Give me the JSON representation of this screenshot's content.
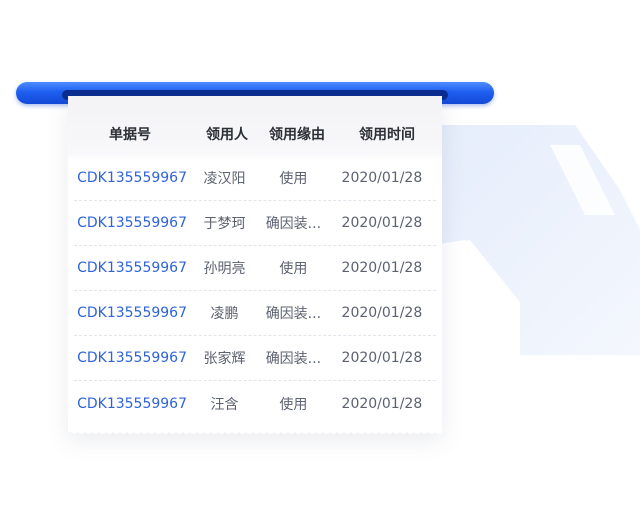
{
  "table": {
    "headers": [
      "单据号",
      "领用人",
      "领用缘由",
      "领用时间"
    ],
    "rows": [
      {
        "id": "CDK135559967",
        "person": "凌汉阳",
        "reason": "使用",
        "date": "2020/01/28"
      },
      {
        "id": "CDK135559967",
        "person": "于梦珂",
        "reason": "确因装...",
        "date": "2020/01/28"
      },
      {
        "id": "CDK135559967",
        "person": "孙明亮",
        "reason": "使用",
        "date": "2020/01/28"
      },
      {
        "id": "CDK135559967",
        "person": "凌鹏",
        "reason": "确因装...",
        "date": "2020/01/28"
      },
      {
        "id": "CDK135559967",
        "person": "张家辉",
        "reason": "确因装...",
        "date": "2020/01/28"
      },
      {
        "id": "CDK135559967",
        "person": "汪含",
        "reason": "使用",
        "date": "2020/01/28"
      }
    ]
  },
  "colors": {
    "accent": "#1f5ff0",
    "link": "#2e63d9",
    "header_text": "#2b2f36",
    "cell_text": "#5d6270"
  }
}
